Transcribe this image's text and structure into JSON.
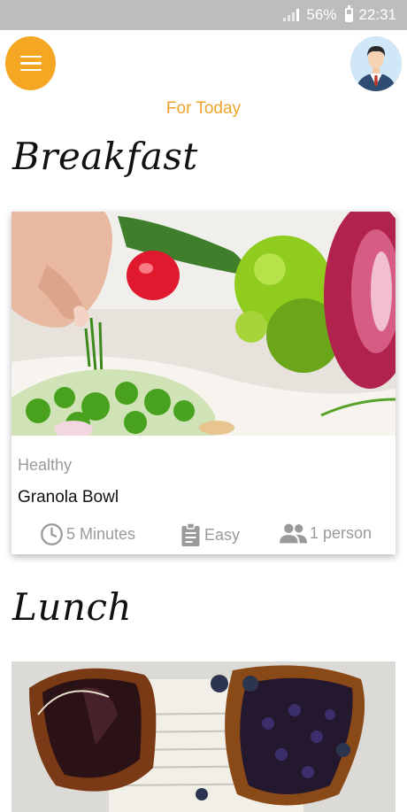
{
  "status_bar": {
    "battery": "56%",
    "time": "22:31",
    "icons": [
      "signal-icon",
      "battery-icon"
    ]
  },
  "header": {
    "menu_icon": "hamburger-menu-icon",
    "avatar_icon": "user-avatar-icon",
    "subtitle": "For Today"
  },
  "sections": [
    {
      "heading": "Breakfast",
      "card": {
        "image": "salad-food-photo",
        "category": "Healthy",
        "title": "Granola Bowl",
        "duration": "5 Minutes",
        "difficulty": "Easy",
        "servings": "1 person",
        "icons": [
          "clock-icon",
          "clipboard-icon",
          "people-icon"
        ]
      }
    },
    {
      "heading": "Lunch",
      "card": {
        "image": "blueberry-pastry-photo"
      }
    }
  ],
  "colors": {
    "accent": "#f5a623",
    "subtitle": "#f0a32a",
    "statusbar": "#bdbdbd",
    "meta_text": "#9a9a9a"
  }
}
